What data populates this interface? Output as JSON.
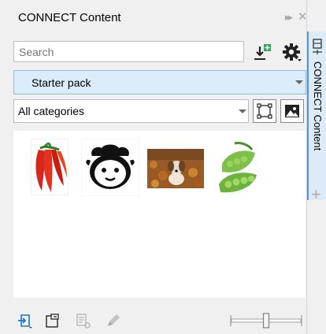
{
  "panel": {
    "title": "CONNECT Content",
    "expand_icon": "double-chevron-right-icon",
    "close_icon": "close-icon"
  },
  "search": {
    "placeholder": "Search",
    "import_icon": "import-icon",
    "settings_icon": "gear-icon"
  },
  "pack_dropdown": {
    "selected": "Starter pack"
  },
  "category_dropdown": {
    "selected": "All categories",
    "view_buttons": [
      "frame-view-icon",
      "image-view-icon"
    ]
  },
  "gallery": {
    "items": [
      {
        "name": "chili-peppers-thumbnail"
      },
      {
        "name": "sheep-face-thumbnail"
      },
      {
        "name": "dog-in-leaves-thumbnail"
      },
      {
        "name": "pea-pods-thumbnail"
      }
    ]
  },
  "bottom_toolbar": {
    "icons": [
      "import-content-icon",
      "new-tray-icon",
      "properties-icon",
      "edit-icon"
    ],
    "zoom_level": 0.5
  },
  "side_tab": {
    "label": "CONNECT Content",
    "add_icon": "add-tab-icon"
  },
  "colors": {
    "accent": "#4f97d3",
    "selected_bg": "#dcecfb",
    "panel_bg": "#f0f0f0"
  }
}
